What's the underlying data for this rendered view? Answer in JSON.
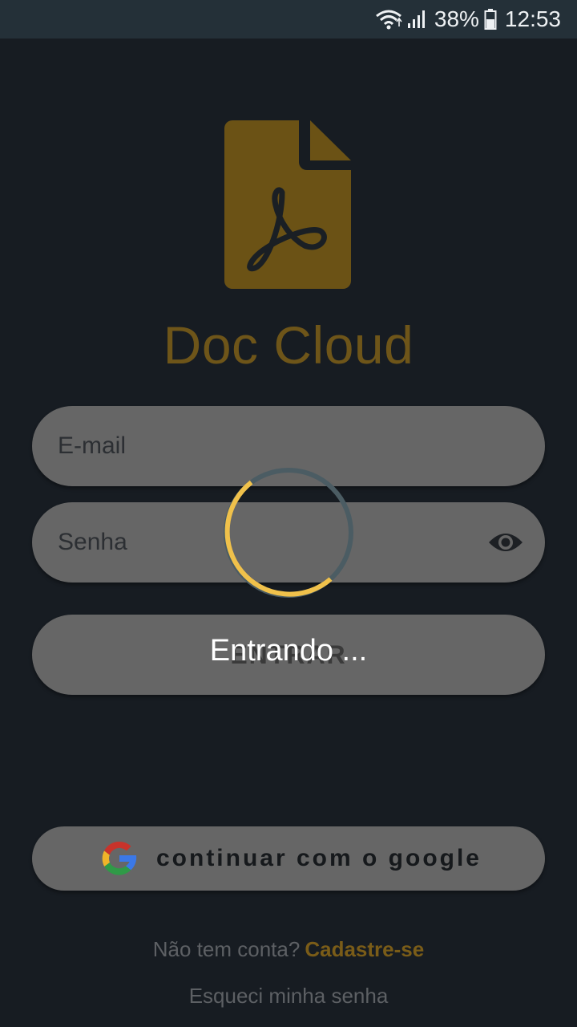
{
  "status_bar": {
    "battery_percent": "38%",
    "time": "12:53",
    "icons": [
      "wifi-icon",
      "signal-icon",
      "battery-icon"
    ]
  },
  "app": {
    "title": "Doc Cloud",
    "logo_icon": "pdf-document-icon",
    "accent_color": "#6e5519"
  },
  "form": {
    "email_placeholder": "E-mail",
    "password_placeholder": "Senha",
    "password_toggle_icon": "eye-icon",
    "login_label": "ENTRAR"
  },
  "loading": {
    "text": "Entrando ..."
  },
  "google": {
    "label": "continuar com o google",
    "icon": "google-icon"
  },
  "footer": {
    "no_account_text": "Não tem conta?",
    "signup_link": "Cadastre-se",
    "forgot_password": "Esqueci minha senha"
  }
}
